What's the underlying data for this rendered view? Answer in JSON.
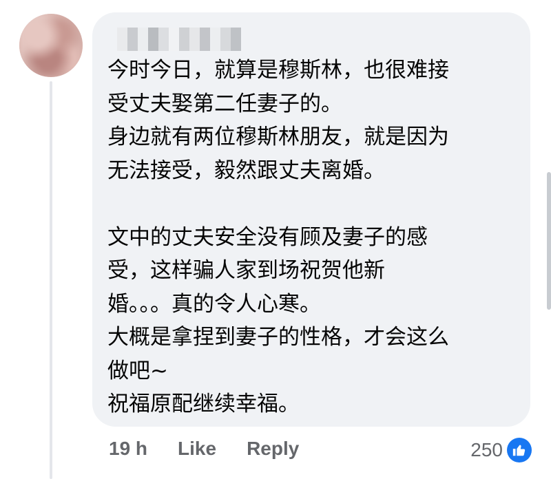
{
  "comment": {
    "author_name_redacted": "",
    "lines": [
      "今时今日，就算是穆斯林，也很难接",
      "受丈夫娶第二任妻子的。",
      "身边就有两位穆斯林朋友，就是因为",
      "无法接受，毅然跟丈夫离婚。",
      "",
      "文中的丈夫安全没有顾及妻子的感",
      "受，这样骗人家到场祝贺他新",
      "婚。。。真的令人心寒。",
      "大概是拿捏到妻子的性格，才会这么",
      "做吧~",
      "祝福原配继续幸福。"
    ]
  },
  "actions": {
    "time": "19 h",
    "like_label": "Like",
    "reply_label": "Reply"
  },
  "reactions": {
    "count": "250",
    "icon": "thumbs-up-icon",
    "color": "#1877f2"
  },
  "colors": {
    "bubble": "#f0f2f5",
    "text": "#050505",
    "meta": "#65676b"
  }
}
